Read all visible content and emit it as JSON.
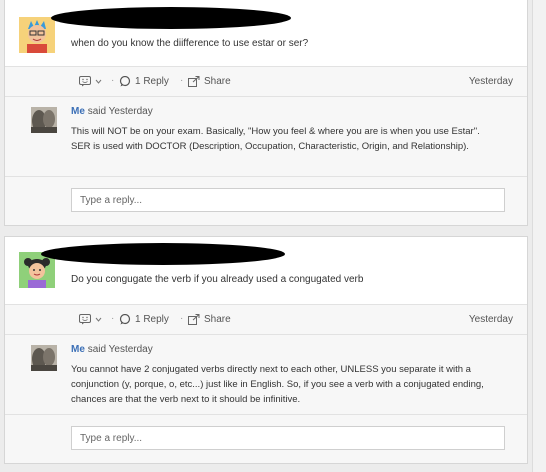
{
  "threads": [
    {
      "question": "when do you know the diifference to use estar or ser?",
      "actions": {
        "reply_count": "1 Reply",
        "share": "Share",
        "time": "Yesterday"
      },
      "reply": {
        "author": "Me",
        "said": "said Yesterday",
        "body": "This will NOT be on your exam. Basically, \"How you feel & where you are is when you use Estar\". SER is used with DOCTOR (Description, Occupation, Characteristic, Origin, and Relationship)."
      },
      "reply_placeholder": "Type a reply..."
    },
    {
      "question": "Do you congugate the verb if you already used a congugated verb",
      "actions": {
        "reply_count": "1 Reply",
        "share": "Share",
        "time": "Yesterday"
      },
      "reply": {
        "author": "Me",
        "said": "said Yesterday",
        "body": "You cannot have 2 conjugated verbs directly next to each other, UNLESS you separate it with a conjunction (y, porque, o, etc...) just like in English. So, if you see a verb with a conjugated ending, chances are that the verb next to it should be infinitive."
      },
      "reply_placeholder": "Type a reply..."
    }
  ],
  "icons": {
    "emoji": "smiley-face-icon",
    "dropdown": "chevron-down-icon",
    "comment": "speech-bubble-icon",
    "share": "share-arrow-icon"
  },
  "colors": {
    "author_link": "#3b6fb6",
    "redaction": "#000000"
  }
}
